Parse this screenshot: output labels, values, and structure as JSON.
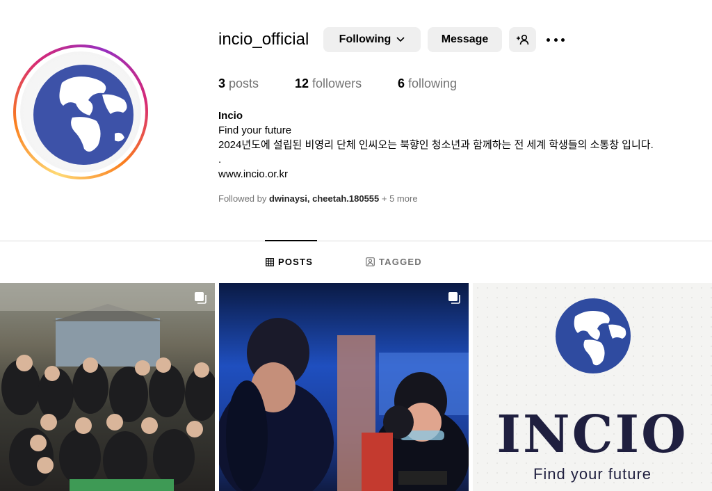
{
  "profile": {
    "username": "incio_official",
    "name": "Incio",
    "bio_line1": "Find your future",
    "bio_line2": "2024년도에 설립된 비영리 단체 인씨오는 북향인 청소년과 함께하는 전 세계 학생들의 소통창 입니다.",
    "bio_line3": ".",
    "website": "www.incio.or.kr"
  },
  "actions": {
    "following_label": "Following",
    "message_label": "Message"
  },
  "stats": {
    "posts_count": "3",
    "posts_label": "posts",
    "followers_count": "12",
    "followers_label": "followers",
    "following_count": "6",
    "following_label": "following"
  },
  "followed_by": {
    "prefix": "Followed by",
    "users": "dwinaysi, cheetah.180555",
    "more": "+ 5 more"
  },
  "tabs": [
    {
      "label": "POSTS",
      "icon": "grid-icon",
      "active": true
    },
    {
      "label": "TAGGED",
      "icon": "tagged-icon",
      "active": false
    }
  ],
  "posts": {
    "logo_word": "INCIO",
    "logo_tagline": "Find your future"
  },
  "colors": {
    "globe_blue": "#3d52a8",
    "button_bg": "#efefef",
    "muted_text": "#737373"
  }
}
